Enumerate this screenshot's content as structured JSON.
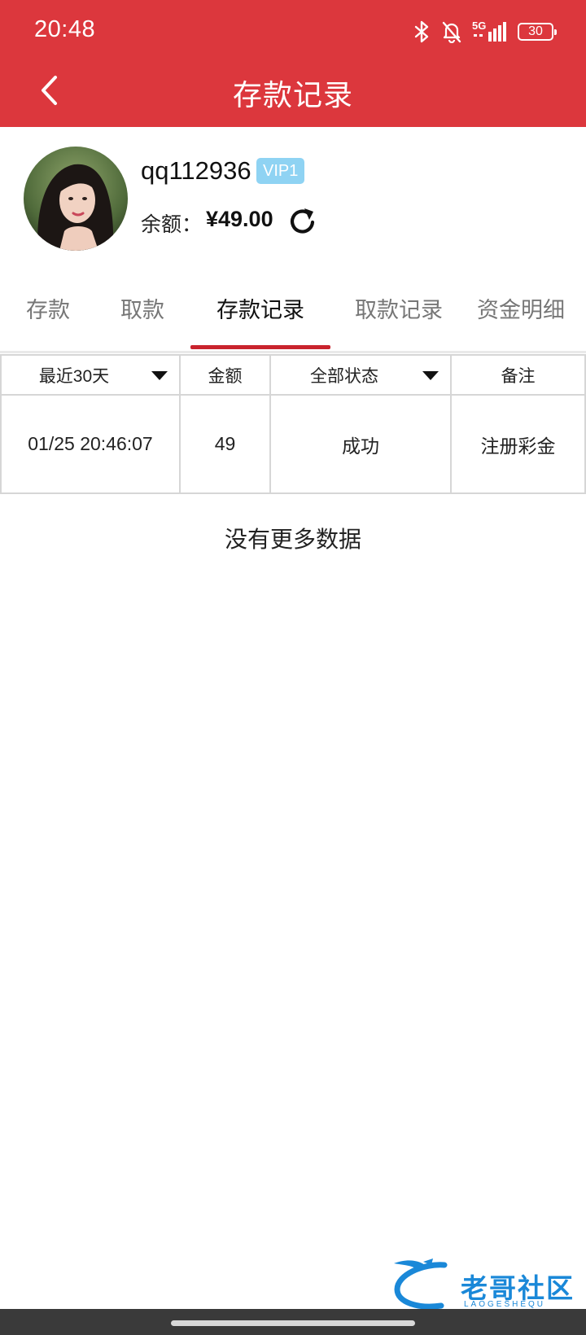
{
  "status_bar": {
    "time": "20:48",
    "network": "5G",
    "battery": "30",
    "icons": [
      "bluetooth-icon",
      "bell-off-icon",
      "signal-icon",
      "battery-icon"
    ]
  },
  "header": {
    "title": "存款记录",
    "back_icon": "chevron-left-icon",
    "background": "#dc373d"
  },
  "profile": {
    "username": "qq112936",
    "vip": "VIP1",
    "balance_label": "余额：",
    "balance_value": "¥49.00",
    "refresh_icon": "refresh-icon"
  },
  "tabs": [
    {
      "label": "存款",
      "active": false
    },
    {
      "label": "取款",
      "active": false
    },
    {
      "label": "存款记录",
      "active": true
    },
    {
      "label": "取款记录",
      "active": false
    },
    {
      "label": "资金明细",
      "active": false
    }
  ],
  "table": {
    "headers": {
      "date_filter": "最近30天",
      "amount": "金额",
      "status_filter": "全部状态",
      "remark": "备注"
    },
    "rows": [
      {
        "time": "01/25 20:46:07",
        "amount": "49",
        "status": "成功",
        "remark": "注册彩金"
      }
    ]
  },
  "footer": {
    "no_more": "没有更多数据"
  },
  "watermark": {
    "text": "老哥社区",
    "sub": "LAOGESHEQU"
  },
  "colors": {
    "accent": "#dc373d",
    "tab_indicator": "#c9232d",
    "vip_badge": "#8fd3f3"
  }
}
